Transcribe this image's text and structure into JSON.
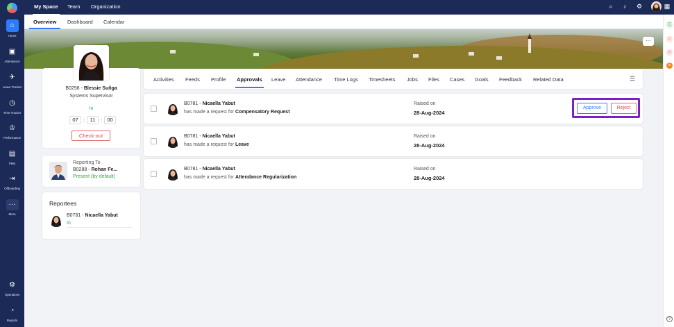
{
  "nav": {
    "items": [
      {
        "label": "Home",
        "icon": "home-icon"
      },
      {
        "label": "Attendance",
        "icon": "calendar-icon"
      },
      {
        "label": "Leave Tracker",
        "icon": "leave-icon"
      },
      {
        "label": "Time Tracker",
        "icon": "stopwatch-icon"
      },
      {
        "label": "Performance",
        "icon": "trophy-icon"
      },
      {
        "label": "Files",
        "icon": "folder-icon"
      },
      {
        "label": "Offboarding",
        "icon": "exit-icon"
      },
      {
        "label": "More",
        "icon": "more-icon"
      },
      {
        "label": "Operations",
        "icon": "gear-icon"
      },
      {
        "label": "Reports",
        "icon": "chart-icon"
      }
    ]
  },
  "topbar": {
    "tabs": [
      "My Space",
      "Team",
      "Organization"
    ]
  },
  "subbar": {
    "tabs": [
      "Overview",
      "Dashboard",
      "Calendar"
    ]
  },
  "profile": {
    "id": "B0258",
    "name": "Blessie Suñga",
    "title": "Systems Supervisor",
    "status": "In",
    "timer": {
      "hh": "07",
      "mm": "11",
      "ss": "00"
    },
    "checkout_label": "Check-out"
  },
  "reporting": {
    "label": "Reporting To",
    "id": "B0288",
    "name": "Rohan Fe...",
    "status": "Present (by default)"
  },
  "reportees": {
    "title": "Reportees",
    "items": [
      {
        "id": "B0781",
        "name": "Nicaella Yabut",
        "status": "In"
      }
    ]
  },
  "tabs": [
    "Activities",
    "Feeds",
    "Profile",
    "Approvals",
    "Leave",
    "Attendance",
    "Time Logs",
    "Timesheets",
    "Jobs",
    "Files",
    "Cases",
    "Goals",
    "Feedback",
    "Related Data"
  ],
  "requests": [
    {
      "id": "B0781",
      "name": "Nicaella Yabut",
      "prefix": "has made a request for",
      "type": "Compensatory Request",
      "raised_label": "Raised on",
      "date": "28-Aug-2024"
    },
    {
      "id": "B0781",
      "name": "Nicaella Yabut",
      "prefix": "has made a request for",
      "type": "Leave",
      "raised_label": "Raised on",
      "date": "28-Aug-2024"
    },
    {
      "id": "B0781",
      "name": "Nicaella Yabut",
      "prefix": "has made a request for",
      "type": "Attendance Regularization",
      "raised_label": "Raised on",
      "date": "28-Aug-2024"
    }
  ],
  "actions": {
    "approve": "Approve",
    "reject": "Reject"
  },
  "banner": {
    "more": "..."
  },
  "colors": {
    "nav_bg": "#1b2a57",
    "accent": "#2f7bff",
    "highlight": "#7a1fc9",
    "danger": "#d94b4b",
    "success": "#2ea84a"
  }
}
